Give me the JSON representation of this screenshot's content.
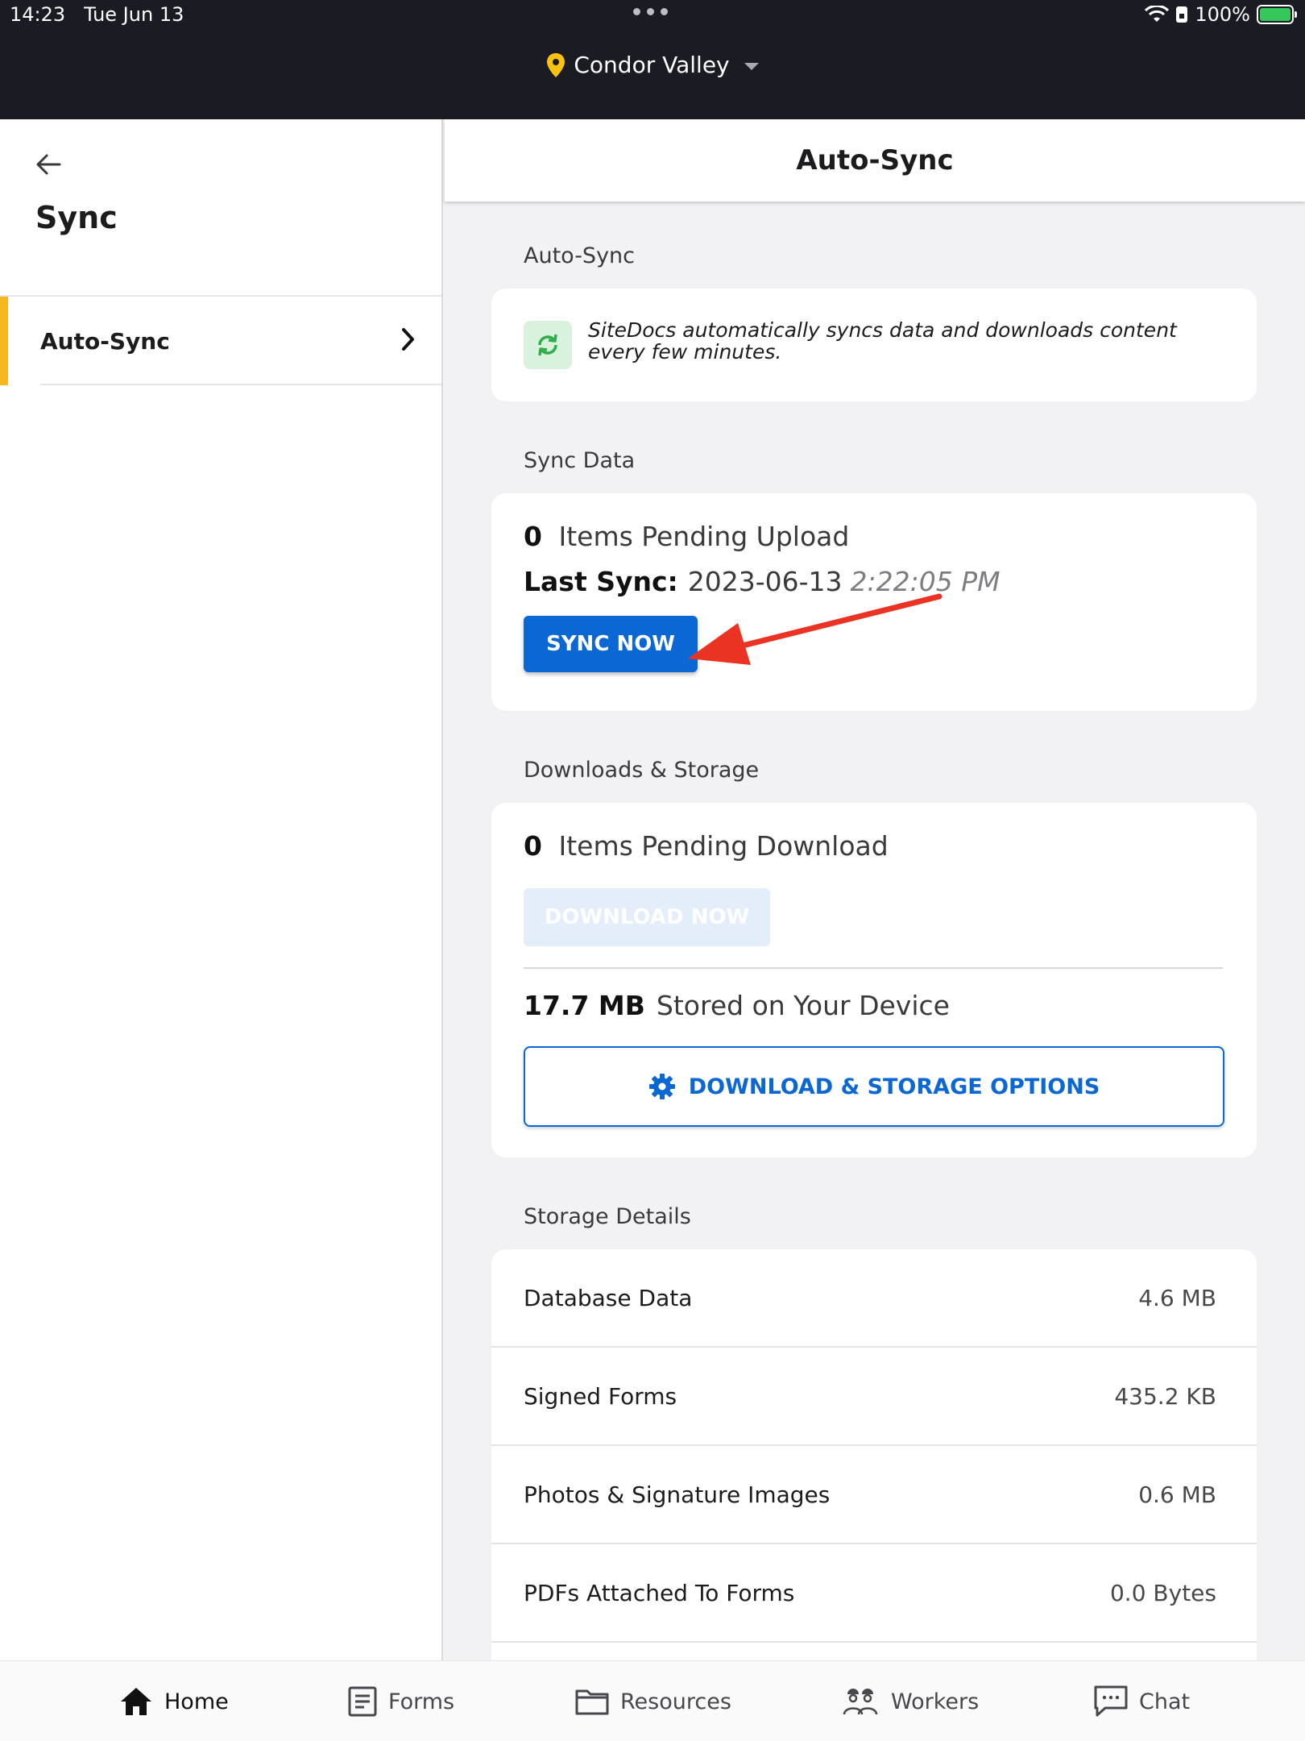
{
  "status_bar": {
    "time": "14:23",
    "date": "Tue Jun 13",
    "battery": "100%"
  },
  "site": {
    "name": "Condor Valley"
  },
  "sidebar": {
    "title": "Sync",
    "items": [
      {
        "label": "Auto-Sync"
      }
    ]
  },
  "main": {
    "header_title": "Auto-Sync",
    "autosync_section": {
      "label": "Auto-Sync",
      "info_text": "SiteDocs automatically syncs data and downloads content every few minutes."
    },
    "sync_section": {
      "label": "Sync Data",
      "pending_count": "0",
      "pending_text": "Items Pending Upload",
      "last_sync_label": "Last Sync:",
      "last_sync_date": "2023-06-13",
      "last_sync_time": "2:22:05 PM",
      "sync_button": "SYNC NOW"
    },
    "downloads_section": {
      "label": "Downloads & Storage",
      "pending_count": "0",
      "pending_text": "Items Pending Download",
      "download_button": "DOWNLOAD NOW",
      "stored_size": "17.7 MB",
      "stored_text": "Stored on Your Device",
      "options_button": "DOWNLOAD & STORAGE OPTIONS"
    },
    "storage_details": {
      "label": "Storage Details",
      "rows": [
        {
          "name": "Database Data",
          "value": "4.6 MB"
        },
        {
          "name": "Signed Forms",
          "value": "435.2 KB"
        },
        {
          "name": "Photos & Signature Images",
          "value": "0.6 MB"
        },
        {
          "name": "PDFs Attached To Forms",
          "value": "0.0 Bytes"
        }
      ]
    }
  },
  "bottom_nav": [
    {
      "label": "Home",
      "icon": "home-icon"
    },
    {
      "label": "Forms",
      "icon": "forms-icon"
    },
    {
      "label": "Resources",
      "icon": "folder-icon"
    },
    {
      "label": "Workers",
      "icon": "workers-icon"
    },
    {
      "label": "Chat",
      "icon": "chat-icon"
    }
  ],
  "colors": {
    "accent": "#f6b820",
    "primary": "#0a67d3",
    "annotation": "#ea3323",
    "topbar": "#1b1b24"
  }
}
